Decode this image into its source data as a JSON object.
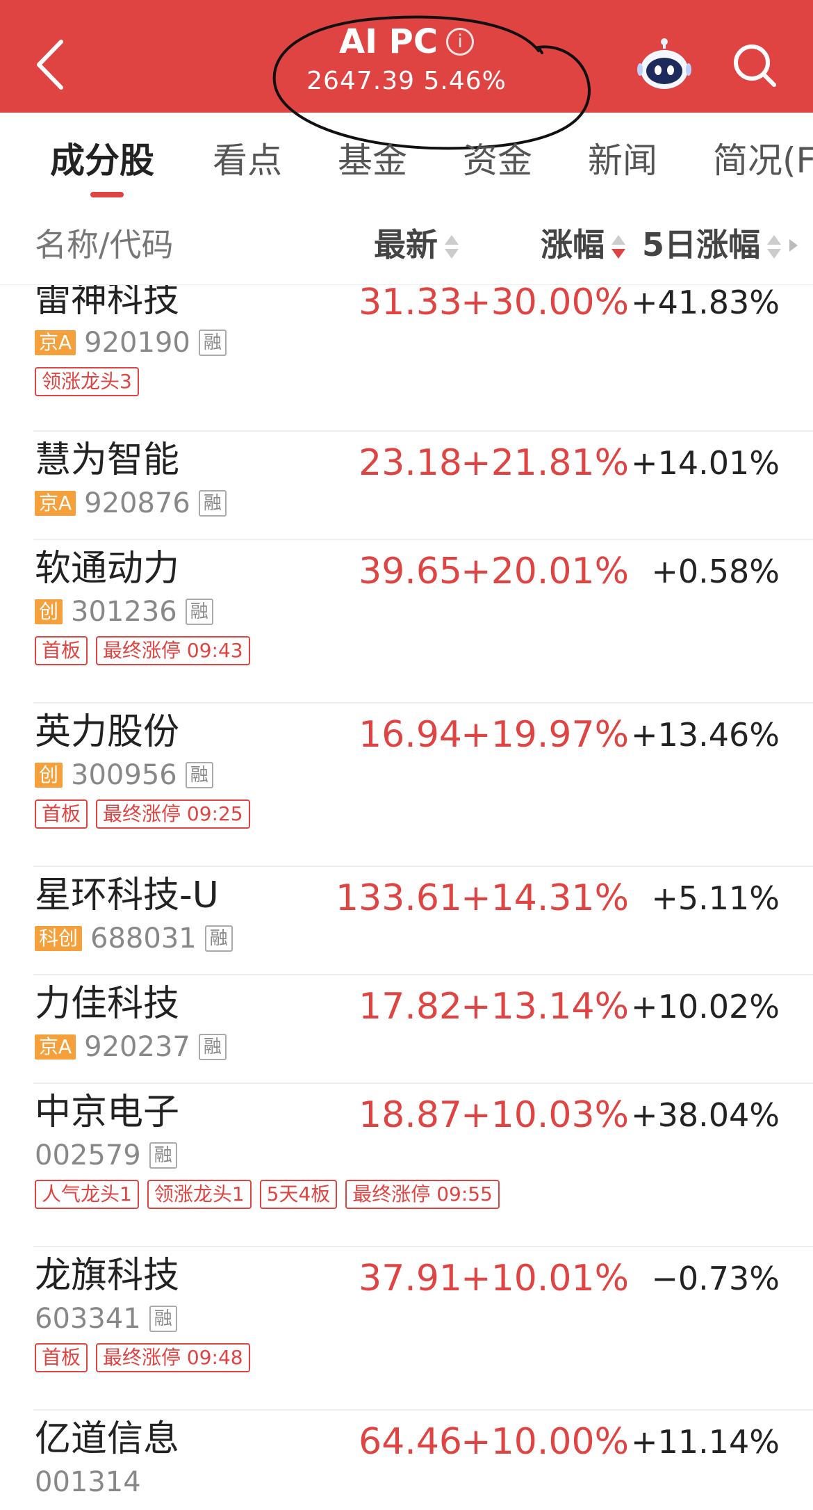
{
  "header": {
    "title": "AI PC",
    "info_icon": "i",
    "index_value": "2647.39",
    "index_change": "5.46%",
    "colors": {
      "bar": "#e04442",
      "text": "#ffffff"
    }
  },
  "tabs": [
    {
      "label": "成分股",
      "active": true
    },
    {
      "label": "看点"
    },
    {
      "label": "基金"
    },
    {
      "label": "资金"
    },
    {
      "label": "新闻"
    },
    {
      "label": "简况(F"
    }
  ],
  "columns": {
    "name": "名称/代码",
    "latest": "最新",
    "change": "涨幅",
    "five_day": "5日涨幅"
  },
  "stocks": [
    {
      "name": "雷神科技",
      "market": "京A",
      "code": "920190",
      "margin": "融",
      "price": "31.33",
      "change": "+30.00%",
      "five_day": "+41.83%",
      "tags": [
        "领涨龙头3"
      ]
    },
    {
      "name": "慧为智能",
      "market": "京A",
      "code": "920876",
      "margin": "融",
      "price": "23.18",
      "change": "+21.81%",
      "five_day": "+14.01%",
      "tags": []
    },
    {
      "name": "软通动力",
      "market": "创",
      "code": "301236",
      "margin": "融",
      "price": "39.65",
      "change": "+20.01%",
      "five_day": "+0.58%",
      "tags": [
        "首板",
        "最终涨停 09:43"
      ]
    },
    {
      "name": "英力股份",
      "market": "创",
      "code": "300956",
      "margin": "融",
      "price": "16.94",
      "change": "+19.97%",
      "five_day": "+13.46%",
      "tags": [
        "首板",
        "最终涨停 09:25"
      ]
    },
    {
      "name": "星环科技-U",
      "market": "科创",
      "code": "688031",
      "margin": "融",
      "price": "133.61",
      "change": "+14.31%",
      "five_day": "+5.11%",
      "tags": []
    },
    {
      "name": "力佳科技",
      "market": "京A",
      "code": "920237",
      "margin": "融",
      "price": "17.82",
      "change": "+13.14%",
      "five_day": "+10.02%",
      "tags": []
    },
    {
      "name": "中京电子",
      "market": "",
      "code": "002579",
      "margin": "融",
      "price": "18.87",
      "change": "+10.03%",
      "five_day": "+38.04%",
      "tags": [
        "人气龙头1",
        "领涨龙头1",
        "5天4板",
        "最终涨停 09:55"
      ]
    },
    {
      "name": "龙旗科技",
      "market": "",
      "code": "603341",
      "margin": "融",
      "price": "37.91",
      "change": "+10.01%",
      "five_day": "−0.73%",
      "tags": [
        "首板",
        "最终涨停 09:48"
      ]
    },
    {
      "name": "亿道信息",
      "market": "",
      "code": "001314",
      "margin": "",
      "price": "64.46",
      "change": "+10.00%",
      "five_day": "+11.14%",
      "tags": []
    }
  ]
}
